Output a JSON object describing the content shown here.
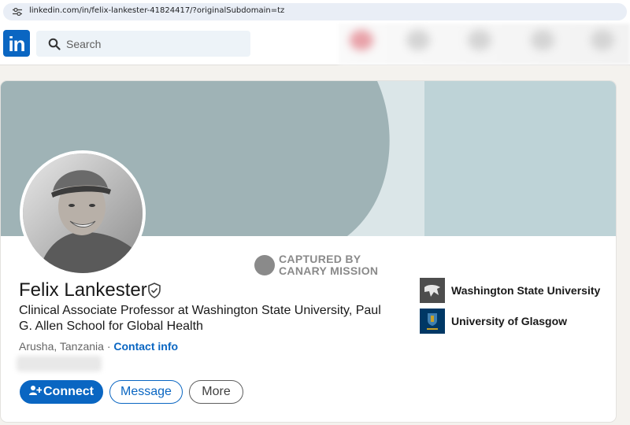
{
  "browser": {
    "url": "linkedin.com/in/felix-lankester-41824417/?originalSubdomain=tz"
  },
  "header": {
    "logo_text": "in",
    "search_placeholder": "Search"
  },
  "watermark": {
    "line1": "CAPTURED BY",
    "line2": "CANARY MISSION"
  },
  "profile": {
    "name": "Felix Lankester",
    "headline": "Clinical Associate Professor at Washington State University, Paul G. Allen School for Global Health",
    "location": "Arusha, Tanzania",
    "separator": " · ",
    "contact_info": "Contact info"
  },
  "actions": {
    "connect": "Connect",
    "message": "Message",
    "more": "More"
  },
  "organizations": [
    {
      "name": "Washington State University",
      "logo_color": "#4d4d4d"
    },
    {
      "name": "University of Glasgow",
      "logo_color": "#003865"
    }
  ],
  "colors": {
    "brand": "#0a66c2",
    "banner_dark": "#9fb3b6",
    "banner_light": "#bed3d7",
    "banner_mid": "#dbe6e8"
  },
  "icons": {
    "url_bar": "tune-icon",
    "search": "search-icon",
    "verified": "shield-check-icon",
    "connect": "add-person-icon"
  }
}
